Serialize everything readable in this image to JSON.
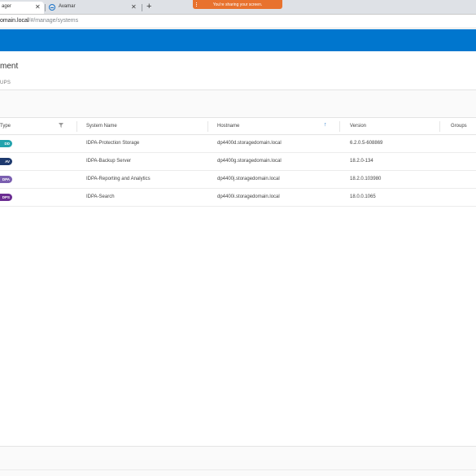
{
  "browser": {
    "tabs": [
      {
        "label": "ager",
        "close": "✕"
      },
      {
        "label": "Avamar",
        "close": "✕"
      }
    ],
    "new_tab": "+",
    "address": {
      "host": "omain.local",
      "path": "/#/manage/systems"
    },
    "sharing_banner": "You're sharing your screen."
  },
  "page": {
    "title": "ment",
    "subtitle": "UPS"
  },
  "table": {
    "columns": {
      "type": "Type",
      "system_name": "System Name",
      "hostname": "Hostname",
      "version": "Version",
      "groups": "Groups"
    },
    "sort_indicator": "↑",
    "rows": [
      {
        "badge": "DD",
        "badge_color": "#23a3ad",
        "name": "IDPA-Protection Storage",
        "hostname": "dp4400d.storagedomain.local",
        "version": "6.2.0.5-608869",
        "groups": ""
      },
      {
        "badge": "AV",
        "badge_color": "#1e3a6e",
        "name": "IDPA-Backup Server",
        "hostname": "dp4400g.storagedomain.local",
        "version": "18.2.0-134",
        "groups": ""
      },
      {
        "badge": "DPA",
        "badge_color": "#7b5fb0",
        "name": "IDPA-Reporting and Analytics",
        "hostname": "dp4400j.storagedomain.local",
        "version": "18.2.0.103980",
        "groups": ""
      },
      {
        "badge": "DPS",
        "badge_color": "#6a2c91",
        "name": "IDPA-Search",
        "hostname": "dp4400i.storagedomain.local",
        "version": "18.0.0.1065",
        "groups": ""
      }
    ]
  },
  "colors": {
    "header_blue": "#0076ce",
    "share_orange": "#e8722e"
  }
}
